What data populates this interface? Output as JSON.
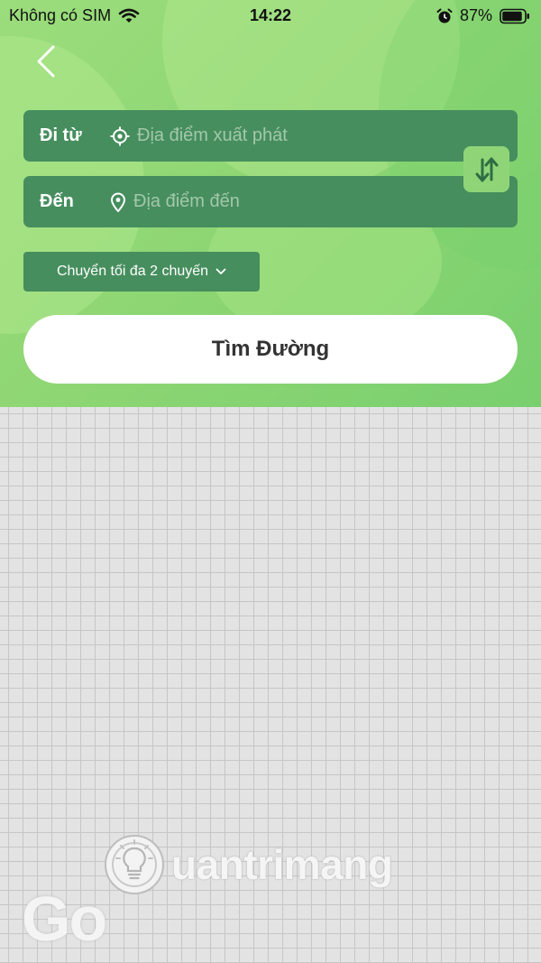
{
  "status_bar": {
    "carrier": "Không có SIM",
    "time": "14:22",
    "battery": "87%"
  },
  "route_form": {
    "from_label": "Đi từ",
    "from_placeholder": "Địa điểm xuất phát",
    "to_label": "Đến",
    "to_placeholder": "Địa điểm đến",
    "transfer_option": "Chuyển tối đa 2 chuyến",
    "search_label": "Tìm Đường"
  },
  "watermark": {
    "site_text": "uantrimang",
    "logo_text": "Go"
  },
  "colors": {
    "header_green": "#8fd674",
    "field_green": "#468e5e",
    "swap_green": "#8fd578",
    "map_bg": "#e3e3e3"
  },
  "icons": [
    "wifi-icon",
    "alarm-icon",
    "battery-icon",
    "back-icon",
    "crosshair-icon",
    "location-pin-icon",
    "swap-icon",
    "chevron-down-icon",
    "lightbulb-icon"
  ]
}
